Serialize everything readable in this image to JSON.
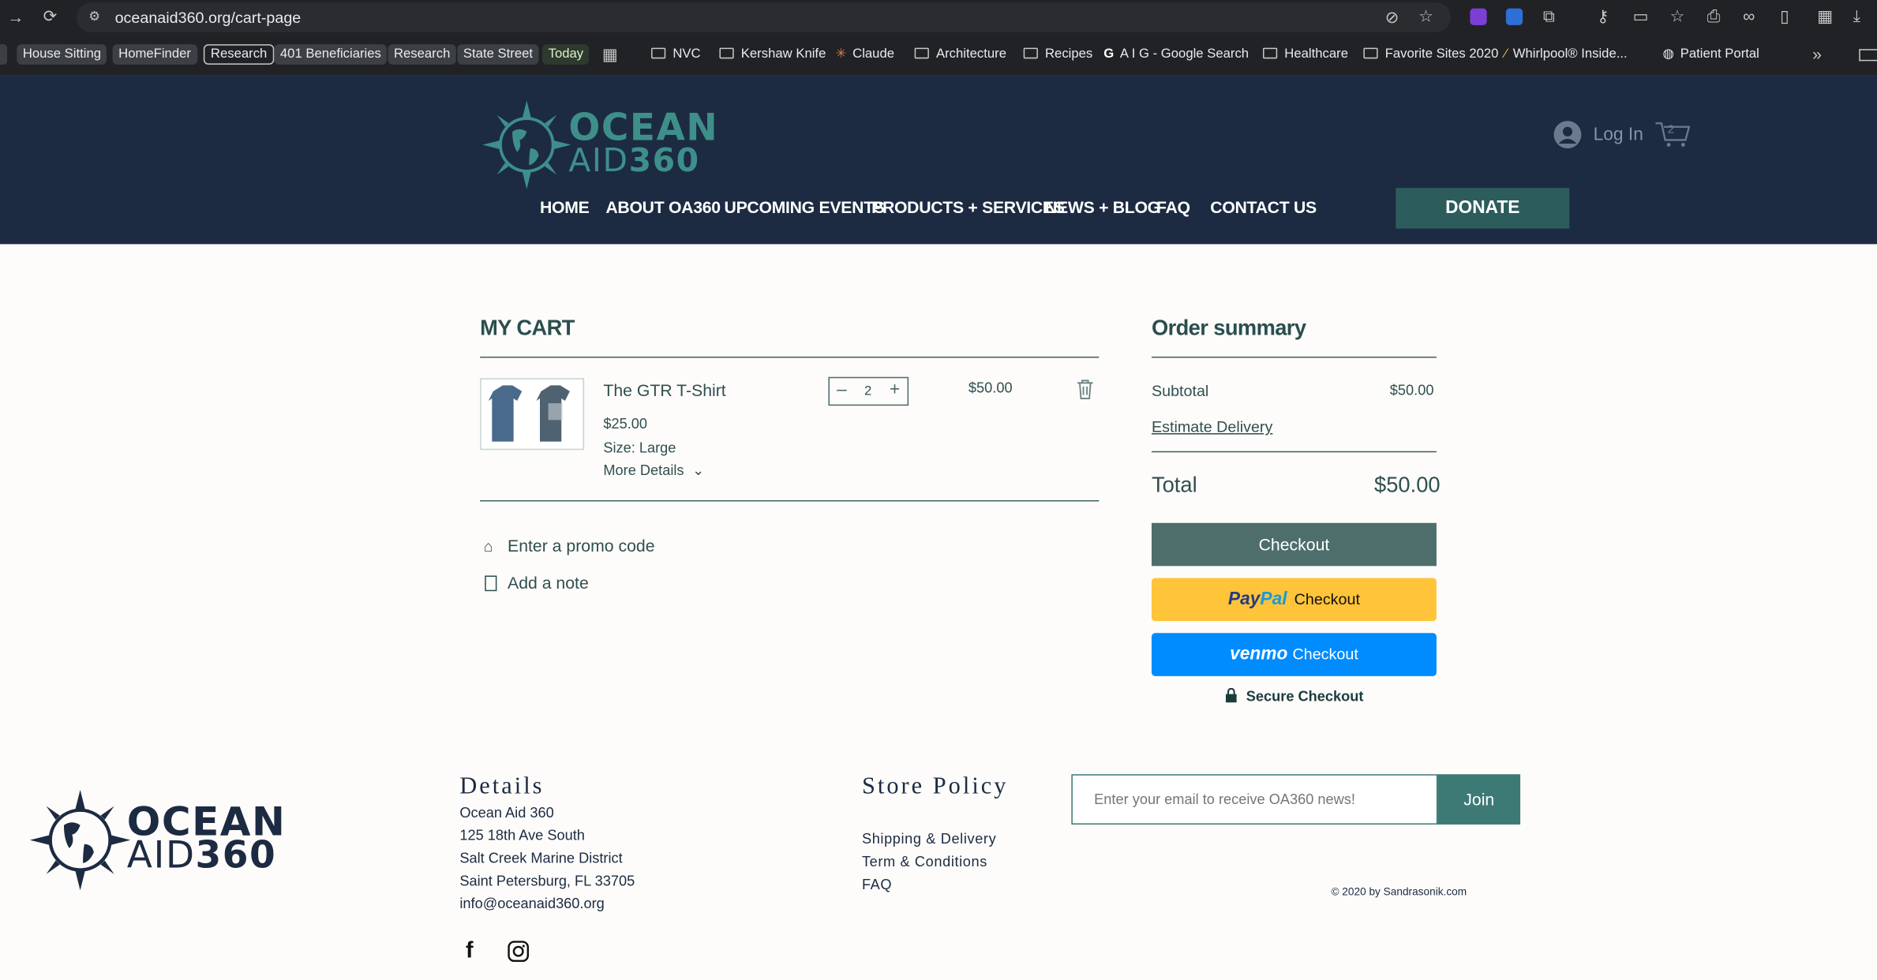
{
  "browser": {
    "url": "oceanaid360.org/cart-page",
    "bookmarks": [
      {
        "label": "House Sitting"
      },
      {
        "label": "HomeFinder"
      },
      {
        "label": "Research"
      },
      {
        "label": "401 Beneficiaries"
      },
      {
        "label": "Research"
      },
      {
        "label": "State Street"
      },
      {
        "label": "Today"
      },
      {
        "label": "NVC"
      },
      {
        "label": "Kershaw Knife"
      },
      {
        "label": "Claude"
      },
      {
        "label": "Architecture"
      },
      {
        "label": "Recipes"
      },
      {
        "label": "A I G - Google Search"
      },
      {
        "label": "Healthcare"
      },
      {
        "label": "Favorite Sites 2020"
      },
      {
        "label": "Whirlpool® Inside..."
      },
      {
        "label": "Patient Portal"
      }
    ]
  },
  "site": {
    "logo_line1": "OCEAN",
    "logo_line2a": "AID",
    "logo_line2b": "360",
    "login_label": "Log In",
    "cart_count": "2",
    "nav": [
      "HOME",
      "ABOUT OA360",
      "UPCOMING EVENTS",
      "PRODUCTS + SERVICES",
      "NEWS + BLOG",
      "FAQ",
      "CONTACT US"
    ],
    "donate_label": "DONATE",
    "colors": {
      "header_bg": "#1c2b42",
      "accent_teal": "#3e8f8a",
      "checkout": "#4e6e6b"
    }
  },
  "cart": {
    "title": "MY CART",
    "item": {
      "name": "The GTR T-Shirt",
      "unit_price": "$25.00",
      "size": "Size: Large",
      "more_details": "More Details",
      "quantity": "2",
      "line_total": "$50.00"
    },
    "promo_label": "Enter a promo code",
    "note_label": "Add a note"
  },
  "summary": {
    "title": "Order summary",
    "subtotal_label": "Subtotal",
    "subtotal_value": "$50.00",
    "delivery_label": "Estimate Delivery",
    "total_label": "Total",
    "total_value": "$50.00",
    "checkout_label": "Checkout",
    "paypal_pay": "Pay",
    "paypal_pal": "Pal",
    "paypal_checkout": "Checkout",
    "venmo_label": "venmo",
    "venmo_checkout": "Checkout",
    "secure_label": "Secure Checkout"
  },
  "footer": {
    "details_title": "Details",
    "address": [
      "Ocean Aid 360",
      "125 18th Ave South",
      "Salt Creek Marine District",
      "Saint Petersburg, FL 33705",
      "info@oceanaid360.org"
    ],
    "policy_title": "Store Policy",
    "policy_links": [
      "Shipping & Delivery",
      "Term & Conditions",
      "FAQ"
    ],
    "email_placeholder": "Enter your email to receive OA360 news!",
    "join_label": "Join",
    "copyright": "© 2020 by Sandrasonik.com"
  }
}
